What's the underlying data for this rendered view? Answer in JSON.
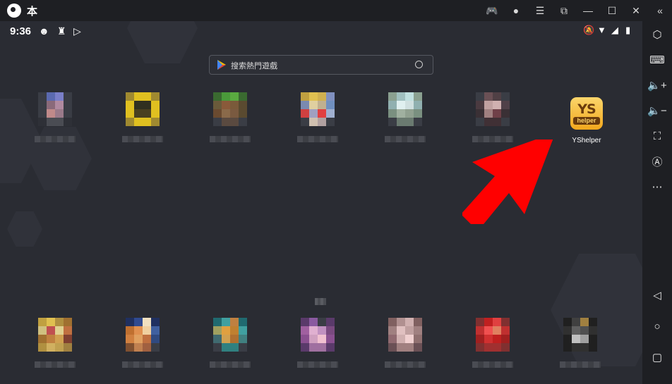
{
  "titlebar": {
    "title": "本",
    "icons": [
      "gamepad-icon",
      "account-icon",
      "menu-icon",
      "screen-rotate-icon",
      "minimize-icon",
      "maximize-icon",
      "close-icon",
      "collapse-sidebar-icon"
    ],
    "glyphs": [
      "🎮",
      "●",
      "☰",
      "⧉",
      "—",
      "☐",
      "✕",
      "«"
    ]
  },
  "status": {
    "time": "9:36"
  },
  "search": {
    "placeholder": "搜索熱門遊戲"
  },
  "featured_app": {
    "name": "YShelper",
    "logo_top": "YS",
    "logo_bottom": "helper"
  },
  "top_apps": [
    {
      "colors": [
        "#3a3d45",
        "#5b6ab0",
        "#7a7fc8",
        "#3a3d45",
        "#3a3d45",
        "#8a6a7a",
        "#b08aa0",
        "#3a3d45",
        "#3a3d45",
        "#c08a8a",
        "#9a7a8a",
        "#3a3d45",
        "#2e3037",
        "#4a4c53",
        "#4a4c53",
        "#2e3037"
      ]
    },
    {
      "colors": [
        "#a08a30",
        "#e0c020",
        "#e0c020",
        "#a08a30",
        "#e0c020",
        "#303020",
        "#303020",
        "#e0c020",
        "#e0c020",
        "#4a4020",
        "#4a4020",
        "#e0c020",
        "#a08a30",
        "#e0c020",
        "#e0c020",
        "#a08a30"
      ]
    },
    {
      "colors": [
        "#3a6a30",
        "#4a9a3a",
        "#5aaa40",
        "#3a6a30",
        "#6a5a3a",
        "#8a5a3a",
        "#7a5a3a",
        "#5a4a30",
        "#6a4a30",
        "#8a6a4a",
        "#7a5a40",
        "#5a4a30",
        "#3a3d45",
        "#5a4a40",
        "#5a4a40",
        "#3a3d45"
      ]
    },
    {
      "colors": [
        "#c0a040",
        "#e0c050",
        "#d0b050",
        "#8090c0",
        "#7a8ab0",
        "#e0d0a0",
        "#c0b090",
        "#7090c0",
        "#d04040",
        "#a0a0c0",
        "#e04040",
        "#a0b0d0",
        "#3a3d45",
        "#d0c0b0",
        "#b0a0a0",
        "#3a3d45"
      ]
    },
    {
      "colors": [
        "#8aa090",
        "#a0c0c0",
        "#c0e0e0",
        "#8aa090",
        "#90b0b0",
        "#e0f0f0",
        "#d0e0e0",
        "#90b0b0",
        "#7a9080",
        "#a0b0a0",
        "#90a090",
        "#7a9080",
        "#3a3d45",
        "#6a7a70",
        "#6a7a70",
        "#3a3d45"
      ]
    },
    {
      "colors": [
        "#3a3d45",
        "#6a5055",
        "#504045",
        "#3a3d45",
        "#4a3a40",
        "#c0a0a0",
        "#d0b0b0",
        "#504048",
        "#3a3035",
        "#a08080",
        "#704048",
        "#3a3035",
        "#3a3d45",
        "#403035",
        "#403035",
        "#3a3d45"
      ]
    }
  ],
  "bottom_apps": [
    {
      "colors": [
        "#c0a040",
        "#e0c050",
        "#b09040",
        "#a07030",
        "#d0c080",
        "#c05050",
        "#e0d090",
        "#c07040",
        "#a07030",
        "#c08040",
        "#d0a050",
        "#804030",
        "#b09040",
        "#d0b060",
        "#c0a050",
        "#a08040"
      ]
    },
    {
      "colors": [
        "#203060",
        "#304a90",
        "#f0e0c0",
        "#203060",
        "#c07030",
        "#e09050",
        "#f0d0a0",
        "#4060a0",
        "#d08040",
        "#e0a060",
        "#c07040",
        "#304a80",
        "#805030",
        "#c08050",
        "#a06040",
        "#3a3d45"
      ]
    },
    {
      "colors": [
        "#206a70",
        "#40a0a0",
        "#c08040",
        "#206a70",
        "#a0a060",
        "#e0a040",
        "#c08030",
        "#40a0a0",
        "#406a70",
        "#d0a050",
        "#b07030",
        "#408080",
        "#3a3d45",
        "#308080",
        "#308080",
        "#3a3d45"
      ]
    },
    {
      "colors": [
        "#5a3a6a",
        "#8a5aa0",
        "#3a3d45",
        "#5a3a6a",
        "#a060a0",
        "#e0b0d0",
        "#c090c0",
        "#7a4a80",
        "#8a5090",
        "#d0a0c0",
        "#f0c0d0",
        "#8a5090",
        "#5a3a6a",
        "#a070a0",
        "#a070a0",
        "#5a3a6a"
      ]
    },
    {
      "colors": [
        "#806060",
        "#b09090",
        "#d0b0b0",
        "#806060",
        "#a08080",
        "#e0c0c0",
        "#c0a0a0",
        "#a08080",
        "#906a70",
        "#d0b0b0",
        "#f0d0d0",
        "#907070",
        "#6a5055",
        "#a08080",
        "#a08080",
        "#6a5055"
      ]
    },
    {
      "colors": [
        "#803030",
        "#c02020",
        "#e04040",
        "#803030",
        "#c03030",
        "#f05050",
        "#e08060",
        "#c03030",
        "#a02020",
        "#d03030",
        "#c02020",
        "#a02020",
        "#803030",
        "#a03030",
        "#a03030",
        "#803030"
      ]
    },
    {
      "colors": [
        "#202020",
        "#404040",
        "#a08040",
        "#202020",
        "#303030",
        "#606060",
        "#505050",
        "#303030",
        "#202020",
        "#c0c0c0",
        "#a0a0a0",
        "#202020",
        "#202020",
        "#303030",
        "#303030",
        "#202020"
      ]
    }
  ],
  "sidebar": {
    "icons": [
      "settings-icon",
      "keyboard-icon",
      "volume-up-icon",
      "volume-down-icon",
      "screenshot-icon",
      "auto-rotate-icon",
      "more-icon",
      "back-icon",
      "home-icon",
      "recents-icon"
    ],
    "glyphs": [
      "⬡",
      "⌨",
      "🔈+",
      "🔈−",
      "⛶",
      "Ⓐ",
      "⋯",
      "◁",
      "○",
      "▢"
    ]
  },
  "colors": {
    "titlebar": "#1e1f23",
    "screen": "#2a2c33",
    "arrow": "#ff0000",
    "ys_gold": "#f2a81d"
  }
}
